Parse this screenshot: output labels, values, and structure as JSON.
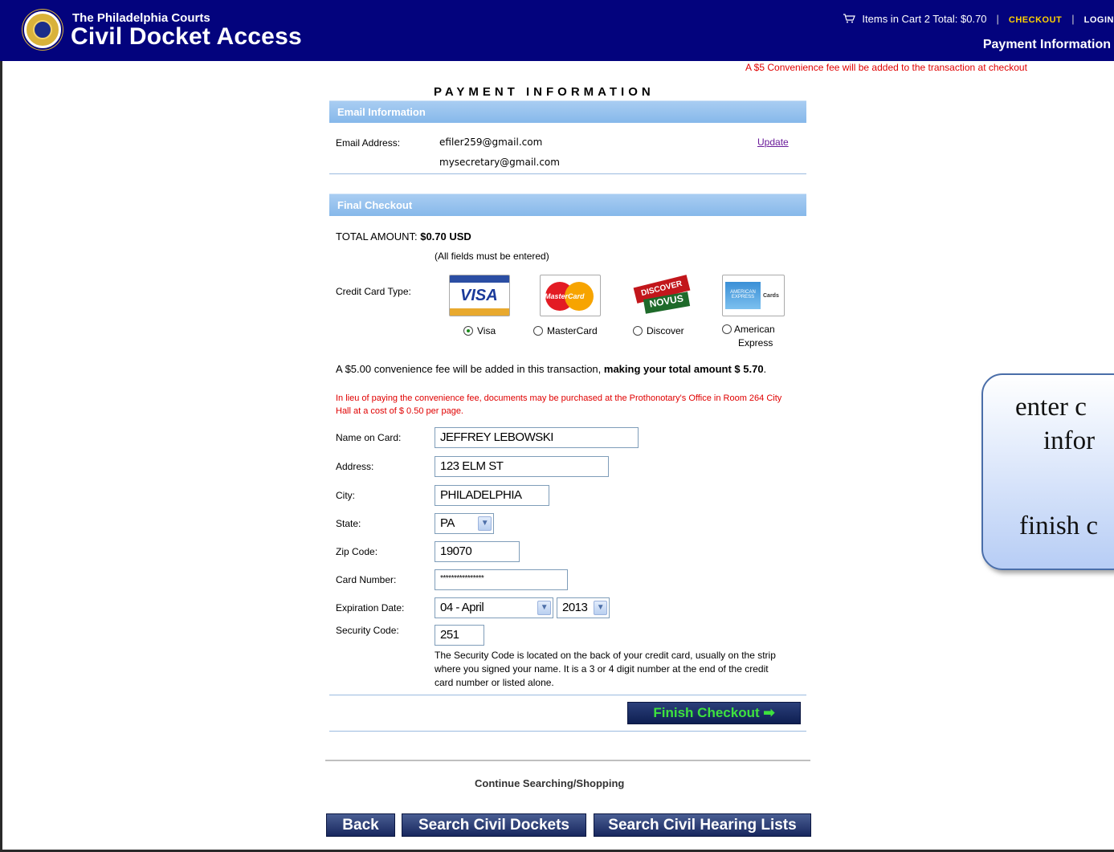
{
  "header": {
    "brand_top": "The Philadelphia Courts",
    "brand_main": "Civil Docket Access",
    "cart_text": "Items in Cart 2  Total: $0.70",
    "sep": "|",
    "checkout": "CHECKOUT",
    "login": "LOGIN",
    "page_sub": "Payment Information"
  },
  "fee_notice": "A $5 Convenience fee will be added to the transaction at checkout",
  "page_title": "PAYMENT INFORMATION",
  "email_section": {
    "title": "Email Information",
    "label": "Email Address:",
    "emails": [
      "efiler259@gmail.com",
      "mysecretary@gmail.com"
    ],
    "update": "Update"
  },
  "checkout_section": {
    "title": "Final Checkout",
    "total_label": "TOTAL AMOUNT: ",
    "total_value": "$0.70 USD",
    "all_fields": "(All fields must be entered)",
    "card_type_label": "Credit Card Type:",
    "card_logos": {
      "visa": "VISA",
      "mastercard": "MasterCard",
      "discover": "DISCOVER",
      "novus": "NOVUS",
      "amex": "AMERICAN EXPRESS",
      "amex_cards": "Cards"
    },
    "card_options": [
      "Visa",
      "MasterCard",
      "Discover",
      "American",
      "Express"
    ],
    "selected_card": "Visa",
    "conv_fee_text": "A $5.00 convenience fee will be added in this transaction, ",
    "conv_fee_bold": "making your total amount $ 5.70",
    "conv_fee_end": ".",
    "conv_red": "In lieu of paying the convenience fee, documents may be purchased at the Prothonotary's Office in Room 264 City Hall at a cost of $ 0.50 per page."
  },
  "form": {
    "name_label": "Name on Card:",
    "name_value": "JEFFREY LEBOWSKI",
    "address_label": "Address:",
    "address_value": "123 ELM ST",
    "city_label": "City:",
    "city_value": "PHILADELPHIA",
    "state_label": "State:",
    "state_value": "PA",
    "zip_label": "Zip Code:",
    "zip_value": "19070",
    "card_label": "Card Number:",
    "card_value": "****************",
    "exp_label": "Expiration Date:",
    "exp_month": "04 - April",
    "exp_year": "2013",
    "sec_label": "Security Code:",
    "sec_value": "251",
    "sec_help": "The Security Code is located on the back of your credit card, usually on the strip where you signed your name. It is a 3 or 4 digit number at the end of the credit card number or listed alone."
  },
  "finish_button": "Finish Checkout",
  "continue_text": "Continue Searching/Shopping",
  "nav_buttons": [
    "Back",
    "Search Civil Dockets",
    "Search Civil Hearing Lists"
  ],
  "callout": {
    "line1": "enter c",
    "line2": "infor",
    "line3": "finish c"
  },
  "icons": {
    "cart": "shopping-cart-icon",
    "seal": "court-seal-icon",
    "arrow": "arrow-right-icon",
    "dropdown": "chevron-down-icon"
  },
  "colors": {
    "header_bg": "#03037d",
    "section_bar": "#86b8ea",
    "fee_red": "#e00000",
    "checkout_yellow": "#ffd100",
    "finish_green": "#3ee23e"
  }
}
